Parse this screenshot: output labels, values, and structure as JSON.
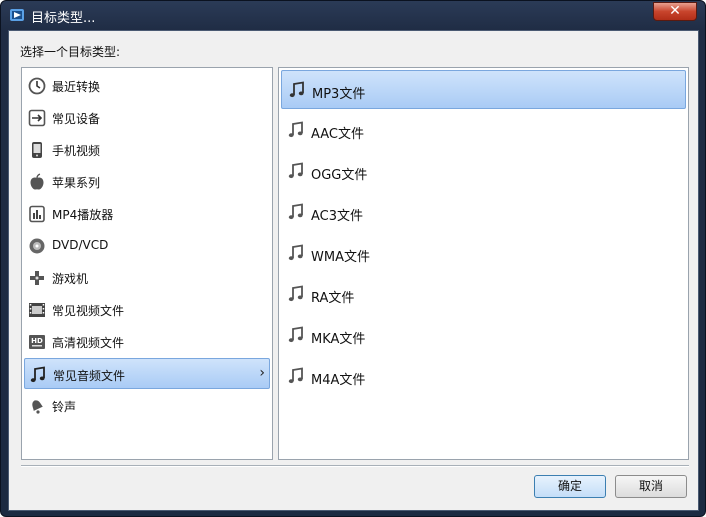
{
  "window": {
    "title": "目标类型..."
  },
  "dialog": {
    "prompt": "选择一个目标类型:"
  },
  "categories": [
    {
      "label": "最近转换",
      "icon": "clock-icon"
    },
    {
      "label": "常见设备",
      "icon": "arrow-box-icon"
    },
    {
      "label": "手机视频",
      "icon": "phone-icon"
    },
    {
      "label": "苹果系列",
      "icon": "apple-icon"
    },
    {
      "label": "MP4播放器",
      "icon": "mp4-player-icon"
    },
    {
      "label": "DVD/VCD",
      "icon": "disc-icon"
    },
    {
      "label": "游戏机",
      "icon": "gamepad-icon"
    },
    {
      "label": "常见视频文件",
      "icon": "film-icon"
    },
    {
      "label": "高清视频文件",
      "icon": "hd-icon"
    },
    {
      "label": "常见音频文件",
      "icon": "music-note-icon",
      "selected": true
    },
    {
      "label": "铃声",
      "icon": "bell-icon"
    }
  ],
  "formats": [
    {
      "label": "MP3文件",
      "selected": true
    },
    {
      "label": "AAC文件"
    },
    {
      "label": "OGG文件"
    },
    {
      "label": "AC3文件"
    },
    {
      "label": "WMA文件"
    },
    {
      "label": "RA文件"
    },
    {
      "label": "MKA文件"
    },
    {
      "label": "M4A文件"
    }
  ],
  "buttons": {
    "ok": "确定",
    "cancel": "取消"
  },
  "colors": {
    "selection_top": "#cfe3fb",
    "selection_bottom": "#a9cbf5",
    "titlebar": "#1f2c44"
  }
}
